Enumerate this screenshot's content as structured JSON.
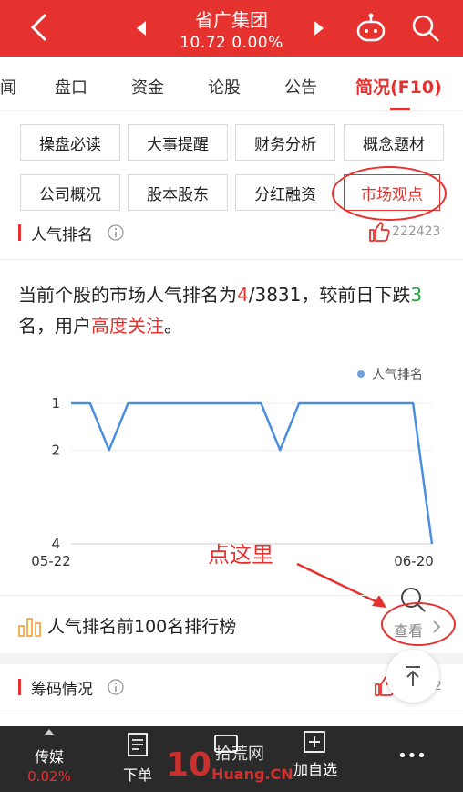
{
  "header": {
    "title": "省广集团",
    "quote": "10.72  0.00%"
  },
  "tabs": [
    {
      "label": "闻"
    },
    {
      "label": "盘口"
    },
    {
      "label": "资金"
    },
    {
      "label": "论股"
    },
    {
      "label": "公告"
    },
    {
      "label": "简况(F10)",
      "active": true
    }
  ],
  "buttons": [
    {
      "label": "操盘必读"
    },
    {
      "label": "大事提醒"
    },
    {
      "label": "财务分析"
    },
    {
      "label": "概念题材"
    },
    {
      "label": "公司概况"
    },
    {
      "label": "股本股东"
    },
    {
      "label": "分红融资"
    },
    {
      "label": "市场观点",
      "selected": true
    }
  ],
  "popularity": {
    "title": "人气排名",
    "likes": "222423",
    "summary": {
      "p1": "当前个股的市场人气排名为",
      "rank": "4",
      "p2": "/3831，较前日下跌",
      "change": "3",
      "p3": "名，用户",
      "attention": "高度关注",
      "p4": "。"
    }
  },
  "chart_data": {
    "type": "line",
    "legend": "人气排名",
    "x_labels": [
      "05-22",
      "06-20"
    ],
    "y_ticks": [
      1,
      2,
      4
    ],
    "ylim": [
      1,
      4
    ],
    "y_inverted": true,
    "values": [
      1,
      1,
      2,
      1,
      1,
      1,
      1,
      1,
      1,
      1,
      1,
      2,
      1,
      1,
      1,
      1,
      1,
      1,
      1,
      4
    ],
    "color": "#4a8fdf"
  },
  "annotation": {
    "text": "点这里"
  },
  "rank_list": {
    "label": "人气排名前100名排行榜",
    "view": "查看"
  },
  "chips": {
    "title": "筹码情况",
    "likes_suffix": "2"
  },
  "bottom_bar": {
    "item1": "传媒",
    "item1_sub": "0.02%",
    "item2": "下单",
    "item4": "加自选",
    "more": "•••"
  },
  "colors": {
    "brand": "#e6322f",
    "line": "#4a8fdf"
  }
}
